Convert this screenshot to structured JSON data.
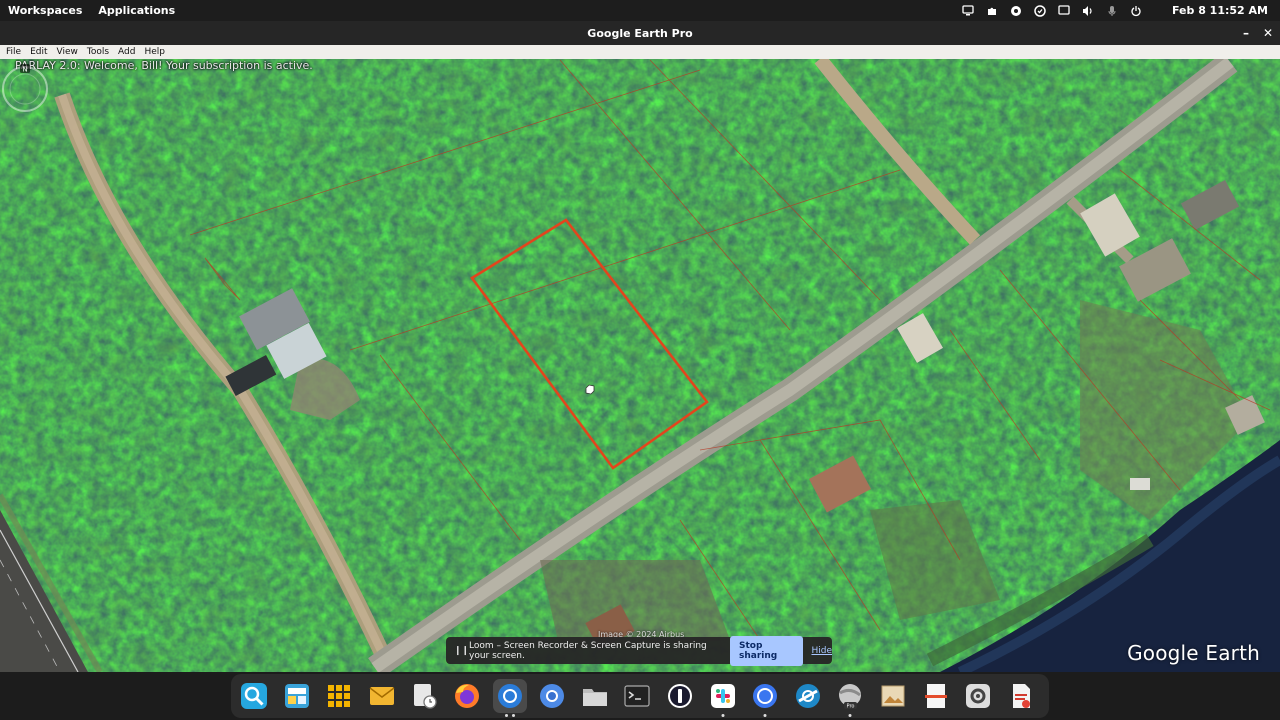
{
  "system_bar": {
    "workspaces": "Workspaces",
    "applications": "Applications",
    "clock": "Feb 8  11:52 AM"
  },
  "window": {
    "title": "Google Earth Pro",
    "minimize": "–",
    "close": "✕"
  },
  "menu": [
    "File",
    "Edit",
    "View",
    "Tools",
    "Add",
    "Help"
  ],
  "map": {
    "banner": "PARLAY 2.0: Welcome, Bill! Your subscription is active.",
    "logo": "Google Earth",
    "compass_label": "N",
    "imagery_credit": "Image © 2024 Airbus",
    "parcel_color": "#e2451d"
  },
  "loom": {
    "message": "Loom – Screen Recorder & Screen Capture is sharing your screen.",
    "stop": "Stop sharing",
    "hide": "Hide"
  },
  "dock": [
    {
      "name": "search-magnifier-icon"
    },
    {
      "name": "files-panel-icon"
    },
    {
      "name": "app-grid-icon"
    },
    {
      "name": "mail-icon"
    },
    {
      "name": "clock-tool-icon"
    },
    {
      "name": "firefox-icon"
    },
    {
      "name": "chrome-icon"
    },
    {
      "name": "chromium-icon"
    },
    {
      "name": "file-manager-icon"
    },
    {
      "name": "terminal-icon"
    },
    {
      "name": "password-manager-icon"
    },
    {
      "name": "slack-icon"
    },
    {
      "name": "signal-icon"
    },
    {
      "name": "browser-icon"
    },
    {
      "name": "google-earth-pro-icon",
      "badge": "Pro"
    },
    {
      "name": "image-viewer-icon"
    },
    {
      "name": "media-icon"
    },
    {
      "name": "settings-icon"
    },
    {
      "name": "document-viewer-icon"
    }
  ]
}
